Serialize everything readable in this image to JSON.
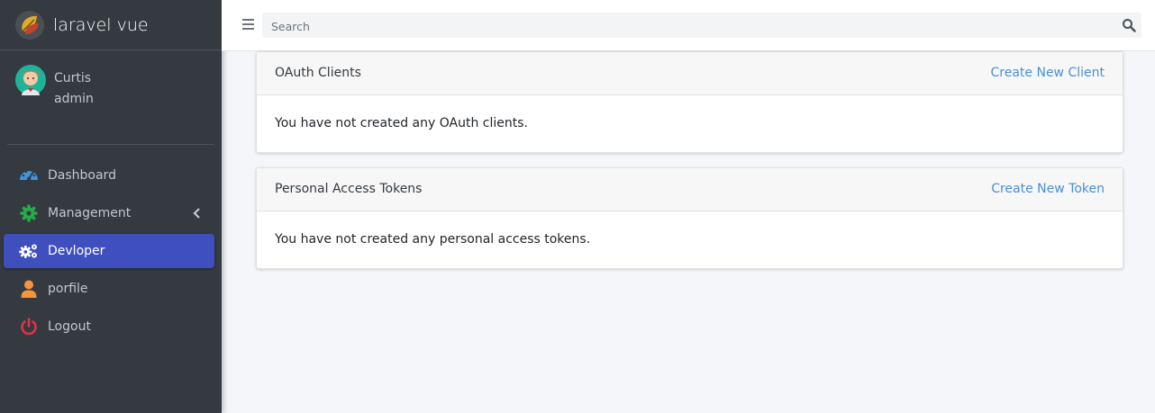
{
  "brand": {
    "name": "laravel vue"
  },
  "user": {
    "name": "Curtis",
    "role": "admin"
  },
  "nav": [
    {
      "label": "Dashboard",
      "icon": "tachometer-icon",
      "color": "#3f93db"
    },
    {
      "label": "Management",
      "icon": "cog-icon",
      "color": "#2aa84a"
    },
    {
      "label": "Devloper",
      "icon": "cogs-icon",
      "color": "#ffffff",
      "active": true
    },
    {
      "label": "porfile",
      "icon": "user-icon",
      "color": "#f6943d"
    },
    {
      "label": "Logout",
      "icon": "power-off-icon",
      "color": "#dc3545"
    }
  ],
  "search": {
    "placeholder": "Search"
  },
  "cards": {
    "oauth": {
      "title": "OAuth Clients",
      "action": "Create New Client",
      "empty": "You have not created any OAuth clients."
    },
    "tokens": {
      "title": "Personal Access Tokens",
      "action": "Create New Token",
      "empty": "You have not created any personal access tokens."
    }
  },
  "colors": {
    "sidebar_bg": "#343a40",
    "active_bg": "#3f4fbd",
    "link": "#4a8fd5"
  }
}
